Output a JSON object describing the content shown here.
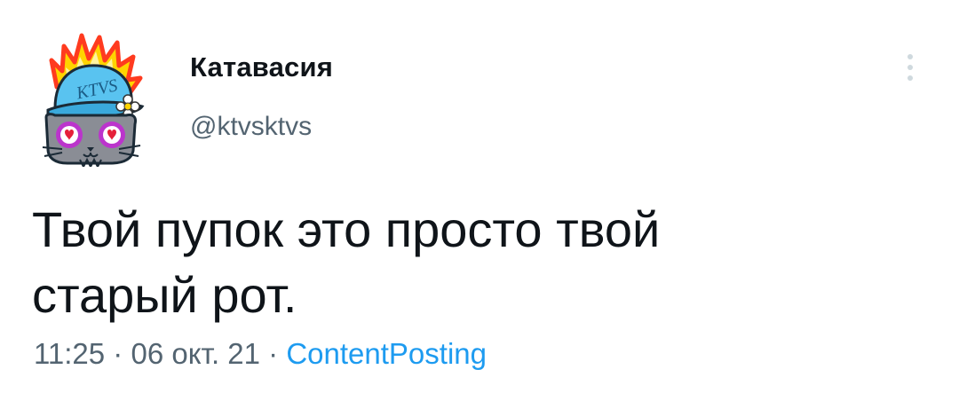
{
  "user": {
    "display_name": "Катавасия",
    "handle": "@ktvsktvs",
    "avatar_icon": "cat-with-flaming-cap-avatar",
    "avatar_cap_text": "KTVS"
  },
  "more_icon": "more-vertical-icon",
  "tweet": {
    "text_line1": "Твой пупок это просто твой",
    "text_line2": "старый рот."
  },
  "meta": {
    "time": "11:25",
    "separator": " · ",
    "date": "06 окт. 21",
    "source": "ContentPosting"
  },
  "colors": {
    "text": "#0f1419",
    "secondary": "#536471",
    "link": "#1d9bf0"
  }
}
